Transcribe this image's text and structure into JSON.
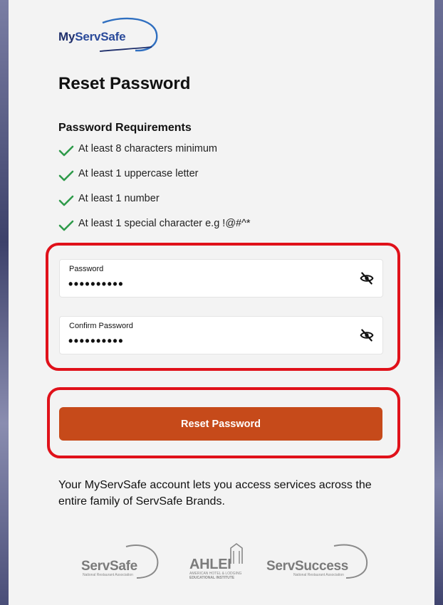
{
  "logo": {
    "part1": "My",
    "part2": "ServSafe"
  },
  "page_title": "Reset Password",
  "requirements": {
    "title": "Password Requirements",
    "items": [
      {
        "label": "At least 8 characters minimum"
      },
      {
        "label": "At least 1 uppercase letter"
      },
      {
        "label": "At least 1 number"
      },
      {
        "label": "At least 1 special character e.g !@#^*"
      }
    ],
    "check_color": "#2e9a4a",
    "check_icon": "check-icon"
  },
  "fields": {
    "password": {
      "label": "Password",
      "value": "••••••••••",
      "icon": "eye-slash-icon"
    },
    "confirm_password": {
      "label": "Confirm Password",
      "value": "••••••••••",
      "icon": "eye-slash-icon"
    }
  },
  "reset_button": {
    "label": "Reset Password",
    "color": "#c64a1a"
  },
  "info_text": "Your MyServSafe account lets you access services across the entire family of ServSafe Brands.",
  "brands": {
    "servsafe": {
      "name": "ServSafe",
      "sub": "National Restaurant Association"
    },
    "ahlei": {
      "name": "AHLEI",
      "sub1": "AMERICAN HOTEL & LODGING",
      "sub2": "EDUCATIONAL INSTITUTE"
    },
    "servsuccess": {
      "name": "ServSuccess",
      "sub": "National Restaurant Association"
    }
  },
  "highlight_color": "#e0111a"
}
